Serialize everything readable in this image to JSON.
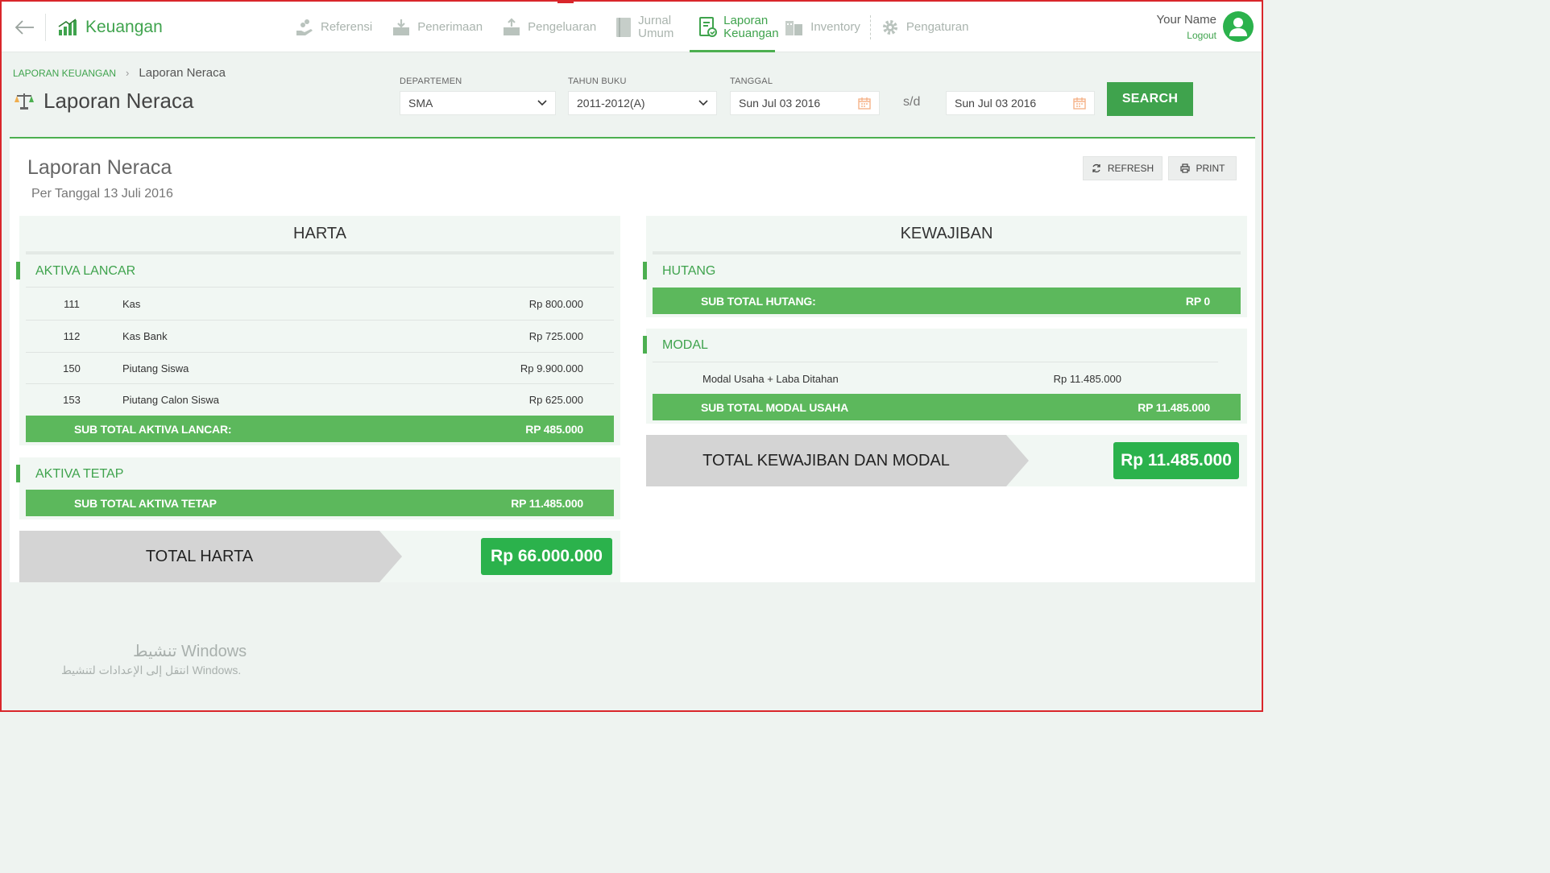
{
  "app": {
    "brand": "Keuangan"
  },
  "nav": {
    "items": [
      {
        "label": "Referensi",
        "icon": "hand-coins-icon"
      },
      {
        "label": "Penerimaan",
        "icon": "inbox-in-icon"
      },
      {
        "label": "Pengeluaran",
        "icon": "inbox-out-icon"
      },
      {
        "label": "Jurnal Umum",
        "icon": "book-icon"
      },
      {
        "label": "Laporan Keuangan",
        "icon": "report-icon"
      },
      {
        "label": "Inventory",
        "icon": "building-icon"
      },
      {
        "label": "Pengaturan",
        "icon": "gear-icon"
      }
    ],
    "active": "Laporan Keuangan"
  },
  "user": {
    "name": "Your Name",
    "logout": "Logout"
  },
  "breadcrumb": {
    "root": "LAPORAN KEUANGAN",
    "current": "Laporan Neraca"
  },
  "page_title": "Laporan Neraca",
  "filters": {
    "departemen": {
      "label": "DEPARTEMEN",
      "value": "SMA"
    },
    "tahun_buku": {
      "label": "TAHUN BUKU",
      "value": "2011-2012(A)"
    },
    "tanggal": {
      "label": "TANGGAL",
      "from": "Sun Jul 03 2016",
      "to": "Sun Jul 03 2016",
      "separator": "s/d"
    },
    "search_label": "SEARCH"
  },
  "report": {
    "title": "Laporan Neraca",
    "subtitle": "Per Tanggal 13 Juli 2016",
    "refresh_label": "REFRESH",
    "print_label": "PRINT"
  },
  "harta": {
    "title": "HARTA",
    "aktiva_lancar": {
      "title": "AKTIVA LANCAR",
      "rows": [
        {
          "code": "111",
          "name": "Kas",
          "amount": "Rp 800.000"
        },
        {
          "code": "112",
          "name": "Kas Bank",
          "amount": "Rp 725.000"
        },
        {
          "code": "150",
          "name": "Piutang Siswa",
          "amount": "Rp 9.900.000"
        },
        {
          "code": "153",
          "name": "Piutang Calon Siswa",
          "amount": "Rp 625.000"
        }
      ],
      "subtotal_label": "SUB TOTAL AKTIVA LANCAR:",
      "subtotal_value": "RP 485.000"
    },
    "aktiva_tetap": {
      "title": "AKTIVA TETAP",
      "subtotal_label": "SUB TOTAL AKTIVA TETAP",
      "subtotal_value": "RP 11.485.000"
    },
    "total_label": "TOTAL HARTA",
    "total_value": "Rp 66.000.000"
  },
  "kewajiban": {
    "title": "KEWAJIBAN",
    "hutang": {
      "title": "HUTANG",
      "subtotal_label": "SUB TOTAL HUTANG:",
      "subtotal_value": "RP 0"
    },
    "modal": {
      "title": "MODAL",
      "rows": [
        {
          "name": "Modal Usaha + Laba Ditahan",
          "amount": "Rp 11.485.000"
        }
      ],
      "subtotal_label": "SUB TOTAL MODAL USAHA",
      "subtotal_value": "RP 11.485.000"
    },
    "total_label": "TOTAL KEWAJIBAN DAN MODAL",
    "total_value": "Rp 11.485.000"
  },
  "watermark": {
    "line1": "تنشيط Windows",
    "line2": "انتقل إلى الإعدادات لتنشيط Windows."
  },
  "colors": {
    "accent": "#3fa34d",
    "subtotal": "#5cb85c",
    "total": "#2bb24c",
    "panel": "#f1f7f3"
  }
}
